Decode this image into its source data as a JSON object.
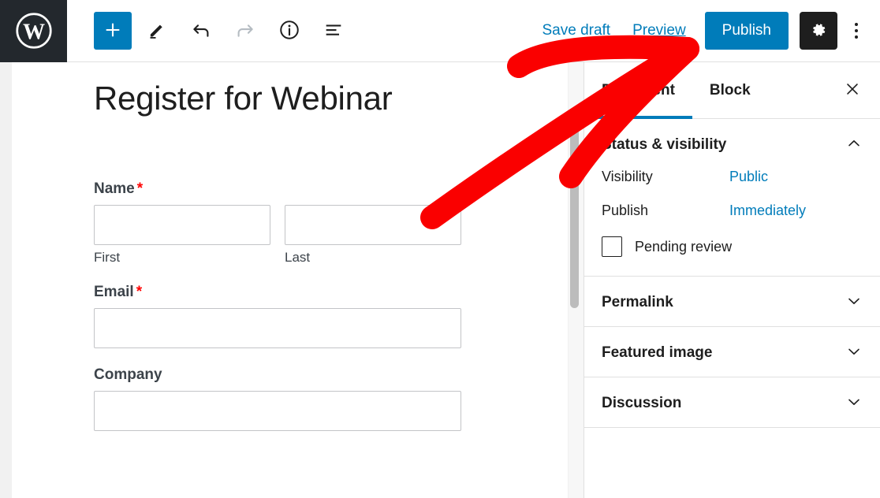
{
  "header": {
    "logo_icon": "wordpress-logo-icon",
    "add_block_icon": "plus-icon",
    "tools": [
      {
        "name": "edit-pencil-icon",
        "label": "Edit",
        "state": "enabled"
      },
      {
        "name": "undo-icon",
        "label": "Undo",
        "state": "enabled"
      },
      {
        "name": "redo-icon",
        "label": "Redo",
        "state": "disabled"
      },
      {
        "name": "info-icon",
        "label": "Details",
        "state": "enabled"
      },
      {
        "name": "list-view-icon",
        "label": "List view",
        "state": "enabled"
      }
    ],
    "save_draft_label": "Save draft",
    "preview_label": "Preview",
    "publish_label": "Publish",
    "settings_icon": "gear-icon",
    "more_icon": "vertical-ellipsis-icon",
    "accent_color": "#007cba",
    "logo_bg_color": "#23282d",
    "settings_bg_color": "#1e1e1e"
  },
  "editor": {
    "post_title": "Register for Webinar",
    "form": {
      "name": {
        "label": "Name",
        "required_marker": "*",
        "first": {
          "sub_label": "First",
          "value": "",
          "placeholder": ""
        },
        "last": {
          "sub_label": "Last",
          "value": "",
          "placeholder": ""
        }
      },
      "email": {
        "label": "Email",
        "required_marker": "*",
        "value": "",
        "placeholder": ""
      },
      "company": {
        "label": "Company",
        "required_marker": "",
        "value": "",
        "placeholder": ""
      }
    }
  },
  "sidebar": {
    "tabs": [
      {
        "label": "Document",
        "active": true
      },
      {
        "label": "Block",
        "active": false
      }
    ],
    "close_icon": "close-x-icon",
    "panels": [
      {
        "title": "Status & visibility",
        "expanded": true,
        "chevron_icon": "chevron-up-icon"
      },
      {
        "title": "Permalink",
        "expanded": false,
        "chevron_icon": "chevron-down-icon"
      },
      {
        "title": "Featured image",
        "expanded": false,
        "chevron_icon": "chevron-down-icon"
      },
      {
        "title": "Discussion",
        "expanded": false,
        "chevron_icon": "chevron-down-icon"
      }
    ],
    "status_panel": {
      "visibility_label": "Visibility",
      "visibility_value": "Public",
      "publish_label": "Publish",
      "publish_value": "Immediately",
      "pending_review_label": "Pending review",
      "pending_review_checked": false
    },
    "link_color": "#007cba"
  },
  "annotation": {
    "type": "arrow",
    "color": "#fa0000",
    "points_to": "Publish"
  }
}
